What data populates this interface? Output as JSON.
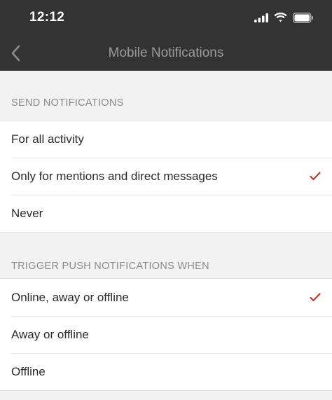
{
  "status_bar": {
    "time": "12:12"
  },
  "nav": {
    "title": "Mobile Notifications"
  },
  "sections": [
    {
      "header": "SEND NOTIFICATIONS",
      "options": [
        {
          "label": "For all activity",
          "selected": false
        },
        {
          "label": "Only for mentions and direct messages",
          "selected": true
        },
        {
          "label": "Never",
          "selected": false
        }
      ]
    },
    {
      "header": "TRIGGER PUSH NOTIFICATIONS WHEN",
      "options": [
        {
          "label": "Online, away or offline",
          "selected": true
        },
        {
          "label": "Away or offline",
          "selected": false
        },
        {
          "label": "Offline",
          "selected": false
        }
      ]
    }
  ],
  "colors": {
    "bar_background": "#333333",
    "accent_check": "#c0392b",
    "page_background": "#f2f2f2"
  },
  "icons": [
    "signal-icon",
    "wifi-icon",
    "battery-icon",
    "back-chevron-icon",
    "checkmark-icon"
  ]
}
